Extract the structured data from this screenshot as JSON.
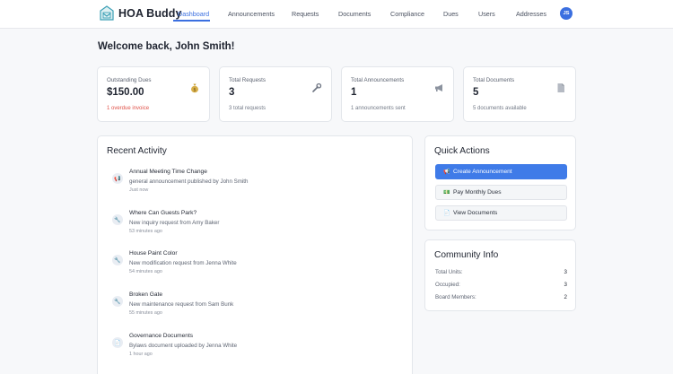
{
  "brand": {
    "name": "HOA Buddy"
  },
  "nav": {
    "items": [
      "Dashboard",
      "Announcements",
      "Requests",
      "Documents",
      "Compliance",
      "Dues",
      "Users",
      "Addresses"
    ],
    "active": "Dashboard",
    "avatar_initials": "JS"
  },
  "welcome": "Welcome back, John Smith!",
  "stats": [
    {
      "label": "Outstanding Dues",
      "value": "$150.00",
      "sub": "1 overdue invoice",
      "icon": "money-bag-icon"
    },
    {
      "label": "Total Requests",
      "value": "3",
      "sub": "3 total requests",
      "icon": "wrench-icon"
    },
    {
      "label": "Total Announcements",
      "value": "1",
      "sub": "1 announcements sent",
      "icon": "megaphone-icon"
    },
    {
      "label": "Total Documents",
      "value": "5",
      "sub": "5 documents available",
      "icon": "document-icon"
    }
  ],
  "recent_activity": {
    "title": "Recent Activity",
    "items": [
      {
        "icon": "megaphone-icon",
        "title": "Annual Meeting Time Change",
        "desc": "general announcement published by John Smith",
        "time": "Just now"
      },
      {
        "icon": "wrench-icon",
        "title": "Where Can Guests Park?",
        "desc": "New inquiry request from Amy Baker",
        "time": "53 minutes ago"
      },
      {
        "icon": "wrench-icon",
        "title": "House Paint Color",
        "desc": "New modification request from Jenna White",
        "time": "54 minutes ago"
      },
      {
        "icon": "wrench-icon",
        "title": "Broken Gate",
        "desc": "New maintenance request from Sam Bunk",
        "time": "55 minutes ago"
      },
      {
        "icon": "document-icon",
        "title": "Governance Documents",
        "desc": "Bylaws document uploaded by Jenna White",
        "time": "1 hour ago"
      }
    ]
  },
  "quick_actions": {
    "title": "Quick Actions",
    "buttons": [
      {
        "label": "Create Announcement",
        "icon": "megaphone-icon",
        "primary": true
      },
      {
        "label": "Pay Monthly Dues",
        "icon": "money-icon",
        "primary": false
      },
      {
        "label": "View Documents",
        "icon": "document-icon",
        "primary": false
      }
    ]
  },
  "community_info": {
    "title": "Community Info",
    "rows": [
      {
        "label": "Total Units:",
        "value": "3"
      },
      {
        "label": "Occupied:",
        "value": "3"
      },
      {
        "label": "Board Members:",
        "value": "2"
      }
    ]
  },
  "colors": {
    "accent": "#3f7be8",
    "warning": "#e0534a"
  }
}
